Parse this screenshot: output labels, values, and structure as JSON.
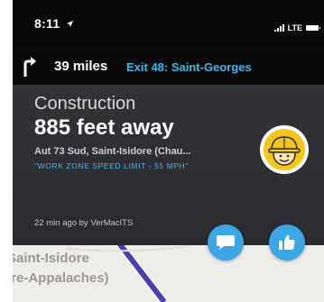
{
  "status_bar": {
    "time": "8:11",
    "network": "LTE",
    "icons": [
      "location-arrow-icon",
      "signal-icon",
      "battery-icon"
    ]
  },
  "direction": {
    "icon": "turn-right-arrow-icon",
    "distance": "39 miles",
    "exit": "Exit 48: Saint-Georges"
  },
  "alert": {
    "type": "Construction",
    "distance": "885 feet away",
    "location": "Aut 73 Sud, Saint-Isidore (Chau...",
    "note": "\"WORK ZONE SPEED LIMIT - 55 MPH\"",
    "reported": "22 min ago by VerMacITS",
    "icon": "construction-worker-icon"
  },
  "map": {
    "label_line1": "Saint-Isidore",
    "label_line2": "(Chaudière-Appalaches)"
  },
  "actions": {
    "comment_icon": "comment-bubble-icon",
    "thumbs_icon": "thumbs-up-icon"
  },
  "colors": {
    "accent": "#3aa7e4",
    "exit_text": "#3ab8e6",
    "card_bg": "#303134",
    "avatar_yellow": "#f5c518",
    "route": "#4a3fb2"
  }
}
